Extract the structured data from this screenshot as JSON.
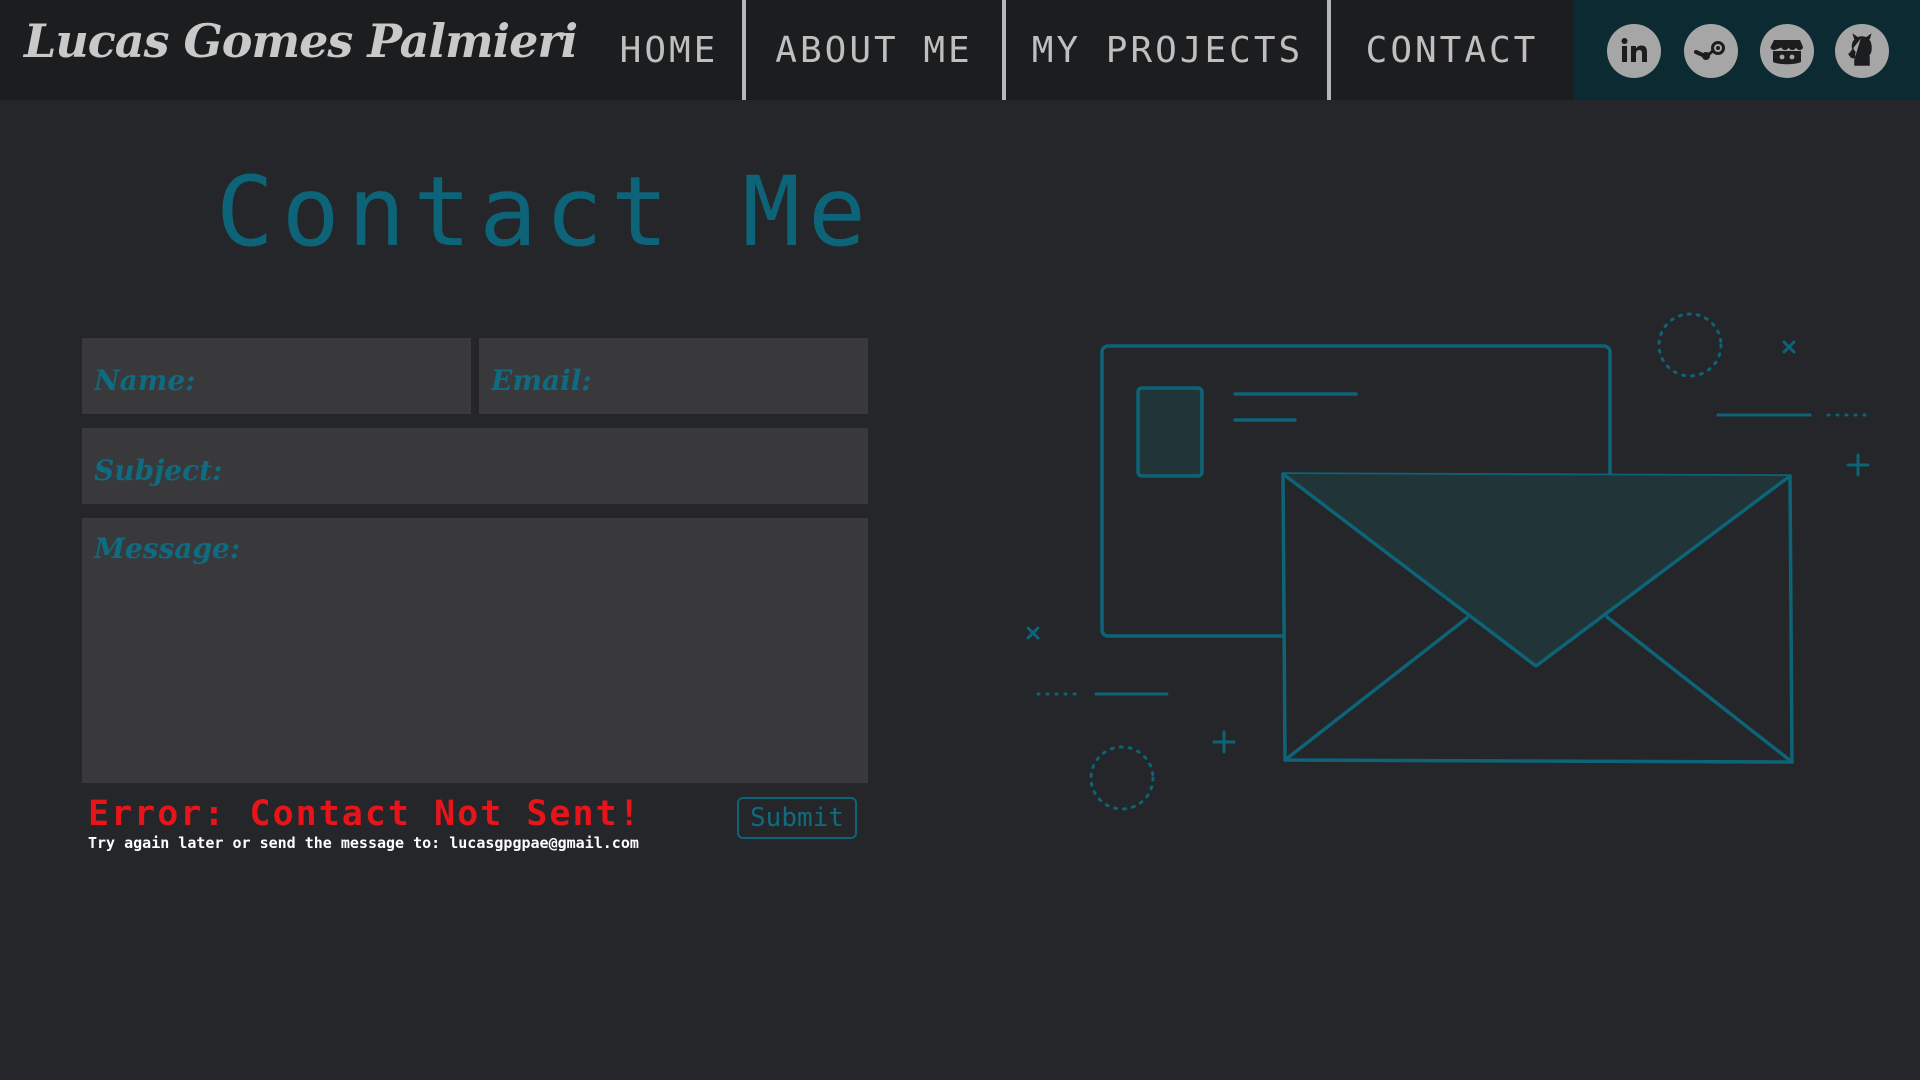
{
  "header": {
    "brand": "Lucas Gomes Palmieri",
    "nav": [
      {
        "label": "HOME"
      },
      {
        "label": "ABOUT ME"
      },
      {
        "label": "MY PROJECTS"
      },
      {
        "label": "CONTACT"
      }
    ],
    "social": [
      {
        "icon": "linkedin-icon"
      },
      {
        "icon": "steam-icon"
      },
      {
        "icon": "itchio-icon"
      },
      {
        "icon": "github-icon"
      }
    ]
  },
  "page": {
    "title": "Contact Me"
  },
  "form": {
    "name_placeholder": "Name:",
    "email_placeholder": "Email:",
    "subject_placeholder": "Subject:",
    "message_placeholder": "Message:",
    "submit_label": "Submit",
    "error_title": "Error: Contact Not Sent!",
    "error_message": "Try again later or send the message to: lucasgpgpae@gmail.com"
  },
  "colors": {
    "background": "#242629",
    "header": "#1c1d1f",
    "accent": "#0d6478",
    "social_bar": "#0c2a31",
    "field": "#39393c",
    "error": "#e8141a"
  }
}
